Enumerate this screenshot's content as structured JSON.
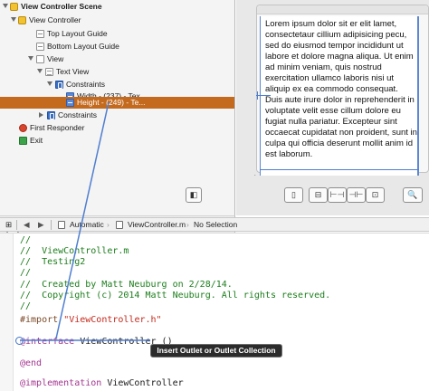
{
  "outline": {
    "rows": [
      {
        "label": "View Controller Scene"
      },
      {
        "label": "View Controller"
      },
      {
        "label": "Top Layout Guide"
      },
      {
        "label": "Bottom Layout Guide"
      },
      {
        "label": "View"
      },
      {
        "label": "Text View"
      },
      {
        "label": "Constraints"
      },
      {
        "label": "Width - (237) - Tex..."
      },
      {
        "label": "Height - (249) - Te..."
      },
      {
        "label": "Constraints"
      },
      {
        "label": "First Responder"
      },
      {
        "label": "Exit"
      }
    ],
    "selected_index": 8,
    "toggle_icon": "outline-toggle-icon"
  },
  "canvas": {
    "lorem": "Lorem ipsum dolor sit er elit lamet, consectetaur cillium adipisicing pecu, sed do eiusmod tempor incididunt ut labore et dolore magna aliqua. Ut enim ad minim veniam, quis nostrud exercitation ullamco laboris nisi ut aliquip ex ea commodo consequat. Duis aute irure dolor in reprehenderit in voluptate velit esse cillum dolore eu fugiat nulla pariatur. Excepteur sint occaecat cupidatat non proident, sunt in culpa qui officia deserunt mollit anim id est laborum."
  },
  "jumpbar": {
    "back": "◀",
    "forward": "▶",
    "mode": "Automatic",
    "file": "ViewController.m",
    "selection": "No Selection"
  },
  "code": {
    "lines": [
      "//",
      "//  ViewController.m",
      "//  Testing2",
      "//",
      "//  Created by Matt Neuburg on 2/28/14.",
      "//  Copyright (c) 2014 Matt Neuburg. All rights reserved.",
      "//",
      "",
      "#import \"ViewController.h\"",
      "",
      "@interface ViewController ()",
      "",
      "@end",
      "",
      "@implementation ViewController"
    ],
    "import_keyword": "#import",
    "import_string": "\"ViewController.h\"",
    "interface_keyword": "@interface",
    "interface_rest": " ViewController ()",
    "end_keyword": "@end",
    "impl_keyword": "@implementation",
    "impl_rest": " ViewController"
  },
  "tooltip": "Insert Outlet or Outlet Collection",
  "colors": {
    "selection": "#c46a1e",
    "constraint_blue": "#3a6fc4",
    "comment_green": "#1c7d1c",
    "keyword_purple": "#a3368f",
    "string_red": "#c4281b"
  }
}
